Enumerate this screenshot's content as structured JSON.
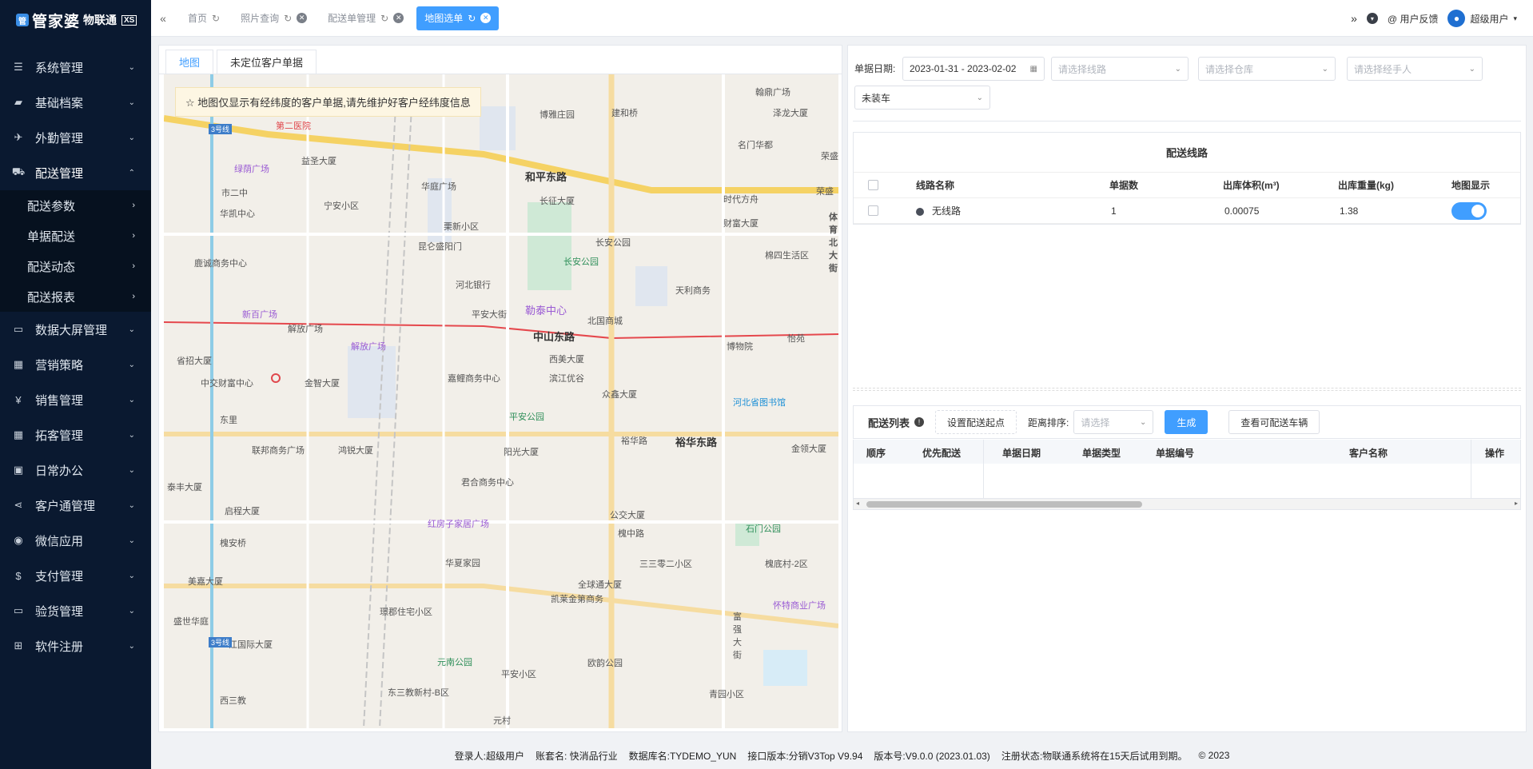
{
  "logo": {
    "mark": "管",
    "text": "管家婆",
    "sub": "物联通",
    "badge": "XS"
  },
  "menu": [
    {
      "label": "系统管理",
      "icon": "☰"
    },
    {
      "label": "基础档案",
      "icon": "▰"
    },
    {
      "label": "外勤管理",
      "icon": "✈"
    },
    {
      "label": "配送管理",
      "icon": "⛟"
    },
    {
      "label": "数据大屏管理",
      "icon": "▭"
    },
    {
      "label": "营销策略",
      "icon": "▦"
    },
    {
      "label": "销售管理",
      "icon": "¥"
    },
    {
      "label": "拓客管理",
      "icon": "▦"
    },
    {
      "label": "日常办公",
      "icon": "▣"
    },
    {
      "label": "客户通管理",
      "icon": "⋖"
    },
    {
      "label": "微信应用",
      "icon": "◉"
    },
    {
      "label": "支付管理",
      "icon": "$"
    },
    {
      "label": "验货管理",
      "icon": "▭"
    },
    {
      "label": "软件注册",
      "icon": "⊞"
    }
  ],
  "submenu": [
    "配送参数",
    "单据配送",
    "配送动态",
    "配送报表"
  ],
  "tabs": [
    {
      "label": "首页"
    },
    {
      "label": "照片查询"
    },
    {
      "label": "配送单管理"
    },
    {
      "label": "地图选单"
    }
  ],
  "topbar": {
    "feedback": "用户反馈",
    "user": "超级用户"
  },
  "map_tabs": [
    "地图",
    "未定位客户单据"
  ],
  "map_notice": "☆ 地图仅显示有经纬度的客户单据,请先维护好客户经纬度信息",
  "map_labels": {
    "l1": "和平东路",
    "l2": "中山东路",
    "l3": "裕华东路",
    "l4": "解放广场",
    "l5": "平安大街",
    "l6": "北国商城",
    "l7": "长安公园",
    "l8": "勒泰中心",
    "l9": "博物院",
    "l10": "新百广场",
    "l11": "河北省图书馆",
    "l12": "平安公园",
    "l13": "石门公园",
    "l14": "元南公园",
    "l15": "绿荫广场",
    "l16": "第二医院",
    "l17": "建和桥",
    "l18": "翰鼎广场",
    "l19": "时代方舟",
    "l20": "财富大厦",
    "l21": "长征大厦",
    "l22": "华庭广场",
    "l23": "宁安小区",
    "l24": "河北银行",
    "l25": "鹿诚商务中心",
    "l26": "嘉鲤商务中心",
    "l27": "滨江优谷",
    "l28": "众鑫大厦",
    "l29": "裕华路",
    "l30": "金领大厦",
    "l31": "君合商务中心",
    "l32": "阳光大厦",
    "l33": "联邦商务广场",
    "l34": "红房子家居广场",
    "l35": "公交大厦",
    "l36": "槐中路",
    "l37": "三三零二小区",
    "l38": "槐底村-2区",
    "l39": "华夏家园",
    "l40": "全球通大厦",
    "l41": "凯莱金第商务",
    "l42": "怀特商业广场",
    "l43": "璟郡住宅小区",
    "l44": "平安小区",
    "l45": "欧韵公园",
    "l46": "青园小区",
    "l47": "一江国际大厦",
    "l48": "西三教",
    "l49": "东三教新村-B区",
    "l50": "元村",
    "l51": "东里",
    "l52": "槐安桥",
    "l53": "美嘉大厦",
    "l54": "盛世华庭",
    "l55": "泰丰大厦",
    "l56": "启程大厦",
    "l57": "鸿锐大厦",
    "l58": "金智大厦",
    "l59": "中交财富中心",
    "l60": "省招大厦",
    "l61": "解放广场",
    "l62": "市二中",
    "l63": "华凯中心",
    "l64": "益圣大厦",
    "l65": "栗新小区",
    "l66": "昆仑盛阳门",
    "l67": "名门华都",
    "l68": "泽龙大厦",
    "l69": "博雅庄园",
    "l70": "棉四生活区",
    "l71": "天利商务",
    "l72": "怡苑",
    "l73": "西美大厦",
    "l74": "3号线",
    "l75": "3号线",
    "l76": "富强大街",
    "l77": "体育北大街",
    "l78": "荣盛",
    "l79": "荣盛",
    "l80": "长安公园"
  },
  "filters": {
    "date_label": "单据日期:",
    "date_value": "2023-01-31 - 2023-02-02",
    "route_placeholder": "请选择线路",
    "warehouse_placeholder": "请选择仓库",
    "handler_placeholder": "请选择经手人",
    "status_value": "未装车"
  },
  "routes": {
    "title": "配送线路",
    "headers": [
      "线路名称",
      "单据数",
      "出库体积(m³)",
      "出库重量(kg)",
      "地图显示"
    ],
    "rows": [
      {
        "name": "无线路",
        "count": "1",
        "volume": "0.00075",
        "weight": "1.38"
      }
    ]
  },
  "list": {
    "title": "配送列表",
    "set_start": "设置配送起点",
    "sort_label": "距离排序:",
    "sort_placeholder": "请选择",
    "generate": "生成",
    "view_vehicles": "查看可配送车辆",
    "headers": [
      "顺序",
      "优先配送",
      "单据日期",
      "单据类型",
      "单据编号",
      "客户名称",
      "操作"
    ]
  },
  "footer": {
    "login": "登录人:超级用户",
    "account": "账套名: 快消品行业",
    "database": "数据库名:TYDEMO_YUN",
    "api": "接口版本:分销V3Top V9.94",
    "version": "版本号:V9.0.0 (2023.01.03)",
    "register": "注册状态:物联通系统将在15天后试用到期。",
    "copyright": "© 2023"
  },
  "colors": {
    "sidebar": "#0a1930",
    "accent": "#409eff"
  }
}
